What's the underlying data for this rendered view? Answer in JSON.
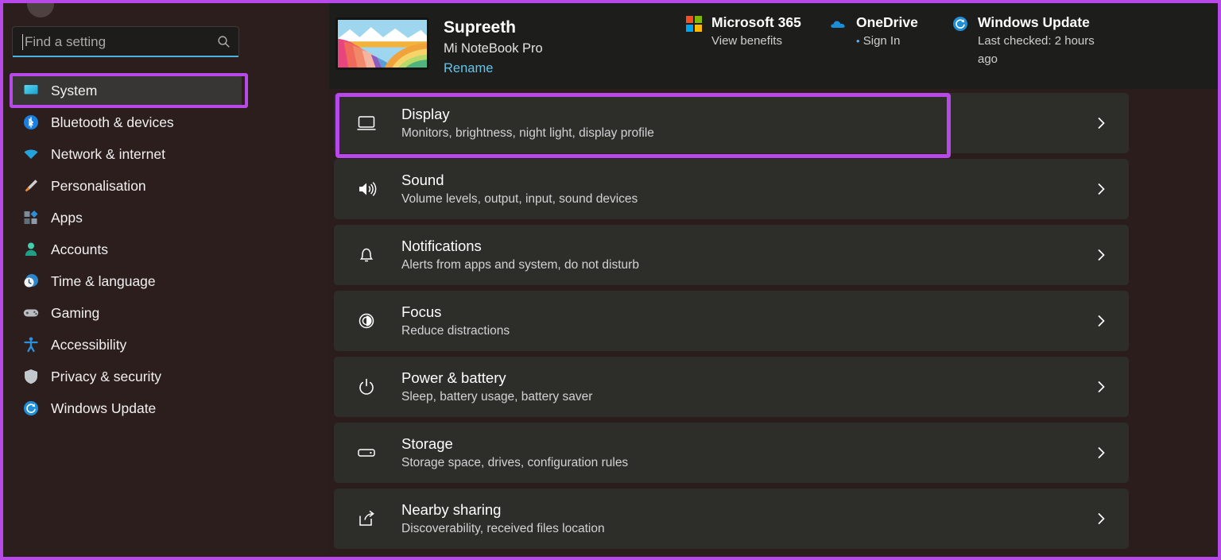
{
  "colors": {
    "annotation": "#b649e8",
    "accent_link": "#62c4e8",
    "search_underline": "#4cb2e0",
    "page_background": "#2b1d1b",
    "header_background": "#1d1d1b",
    "card_background": "#2d2d2a",
    "nav_selected_background": "#373634"
  },
  "search": {
    "placeholder": "Find a setting",
    "value": "",
    "icon": "search-icon"
  },
  "sidebar": {
    "items": [
      {
        "label": "System",
        "icon": "monitor-icon",
        "selected": true
      },
      {
        "label": "Bluetooth & devices",
        "icon": "bluetooth-icon",
        "selected": false
      },
      {
        "label": "Network & internet",
        "icon": "wifi-icon",
        "selected": false
      },
      {
        "label": "Personalisation",
        "icon": "paintbrush-icon",
        "selected": false
      },
      {
        "label": "Apps",
        "icon": "apps-icon",
        "selected": false
      },
      {
        "label": "Accounts",
        "icon": "person-icon",
        "selected": false
      },
      {
        "label": "Time & language",
        "icon": "clock-globe-icon",
        "selected": false
      },
      {
        "label": "Gaming",
        "icon": "gamepad-icon",
        "selected": false
      },
      {
        "label": "Accessibility",
        "icon": "accessibility-icon",
        "selected": false
      },
      {
        "label": "Privacy & security",
        "icon": "shield-icon",
        "selected": false
      },
      {
        "label": "Windows Update",
        "icon": "update-icon",
        "selected": false
      }
    ]
  },
  "header": {
    "device": {
      "name": "Supreeth",
      "model": "Mi NoteBook Pro",
      "rename_label": "Rename",
      "thumbnail_icon": "wallpaper-thumbnail"
    },
    "services": [
      {
        "title": "Microsoft 365",
        "subtitle": "View benefits",
        "icon": "microsoft-logo-icon",
        "bullet": ""
      },
      {
        "title": "OneDrive",
        "subtitle": "Sign In",
        "icon": "onedrive-cloud-icon",
        "bullet": "•"
      },
      {
        "title": "Windows Update",
        "subtitle": "Last checked: 2 hours ago",
        "icon": "update-icon",
        "bullet": ""
      }
    ]
  },
  "main": {
    "items": [
      {
        "title": "Display",
        "subtitle": "Monitors, brightness, night light, display profile",
        "icon": "monitor-outline-icon",
        "highlighted": true
      },
      {
        "title": "Sound",
        "subtitle": "Volume levels, output, input, sound devices",
        "icon": "speaker-icon",
        "highlighted": false
      },
      {
        "title": "Notifications",
        "subtitle": "Alerts from apps and system, do not disturb",
        "icon": "bell-icon",
        "highlighted": false
      },
      {
        "title": "Focus",
        "subtitle": "Reduce distractions",
        "icon": "focus-icon",
        "highlighted": false
      },
      {
        "title": "Power & battery",
        "subtitle": "Sleep, battery usage, battery saver",
        "icon": "power-icon",
        "highlighted": false
      },
      {
        "title": "Storage",
        "subtitle": "Storage space, drives, configuration rules",
        "icon": "storage-icon",
        "highlighted": false
      },
      {
        "title": "Nearby sharing",
        "subtitle": "Discoverability, received files location",
        "icon": "nearby-sharing-icon",
        "highlighted": false
      }
    ],
    "chevron_icon": "chevron-right-icon"
  }
}
